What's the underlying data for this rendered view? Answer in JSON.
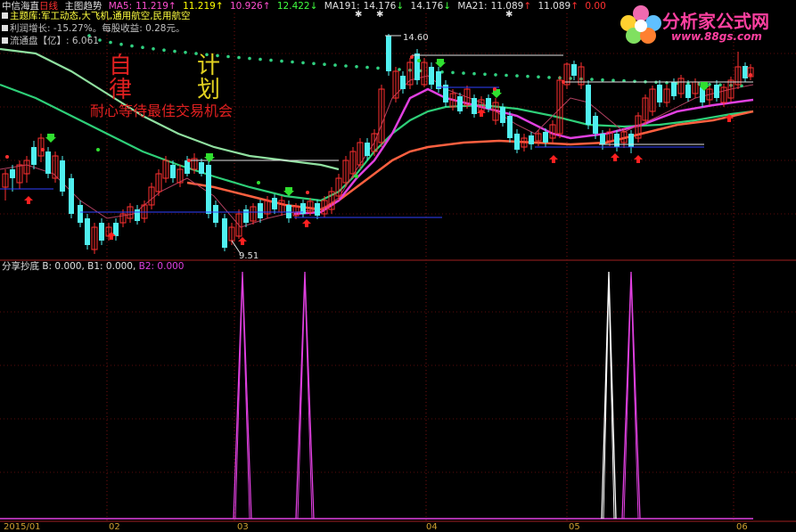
{
  "header": {
    "stock_name": "中信海直",
    "period": "日线",
    "mode": "主图趋势",
    "ma5_label": "MA5:",
    "ma5_values": [
      "11.219",
      "11.219",
      "10.926",
      "12.422"
    ],
    "ma5_arrows": [
      "↑",
      "↑",
      "↑",
      "↓"
    ],
    "ma191_label": "MA191:",
    "ma191_values": [
      "14.176",
      "14.176"
    ],
    "ma191_arrows": [
      "↓",
      "↓"
    ],
    "ma21_label": "MA21:",
    "ma21_values": [
      "11.089",
      "11.089"
    ],
    "ma21_arrows": [
      "↑",
      "↑"
    ],
    "last_value": "0.00",
    "colors": {
      "ma5_1": "#ff4fd0",
      "ma5_2": "#ffff00",
      "ma5_3": "#ff2020",
      "ma5_4": "#40ff40",
      "ma191": "#e0e0e0",
      "ma21": "#e0e0e0",
      "last": "#ff2020"
    }
  },
  "info": {
    "main_business_label": "主题库:",
    "main_business_value": "军工动态,大飞机,通用航空,民用航空",
    "profit_growth": "利润增长: -15.27%。每股收益: 0.28元。",
    "float_shares": "流通盘【亿】: 6.061"
  },
  "slogan": {
    "char1": "自",
    "char2": "律",
    "char3": "计",
    "char4": "划",
    "text": "耐心等待最佳交易机会"
  },
  "price_annotations": {
    "high_label": "14.60",
    "low_label": "9.51"
  },
  "indicator": {
    "name": "分享抄底",
    "b_label": "B: 0.000,",
    "b1_label": "B1: 0.000,",
    "b2_label": "B2: 0.000"
  },
  "x_axis": {
    "labels": [
      "2015/01",
      "02",
      "03",
      "04",
      "05",
      "06"
    ]
  },
  "logo": {
    "title": "分析家公式网",
    "url": "www.88gs.com"
  },
  "chart_data": [
    {
      "type": "candlestick",
      "title": "中信海直 日线",
      "series": [
        {
          "name": "MA5",
          "color": "#ff4fd0"
        },
        {
          "name": "MA191",
          "color": "#60e090"
        },
        {
          "name": "MA21",
          "color": "#ff6040"
        }
      ],
      "ylim": [
        9.2,
        15.2
      ],
      "annotations": [
        "14.60",
        "9.51"
      ]
    },
    {
      "type": "line",
      "title": "分享抄底",
      "series": [
        {
          "name": "B",
          "values": [
            0
          ]
        },
        {
          "name": "B1",
          "values": [
            0
          ]
        },
        {
          "name": "B2",
          "values": [
            0
          ]
        }
      ],
      "spikes_magenta_x": [
        272,
        342,
        708
      ],
      "spikes_white_x": [
        683
      ]
    }
  ]
}
